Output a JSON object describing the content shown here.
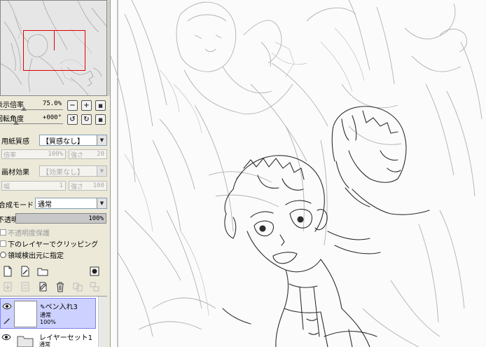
{
  "navigator": {
    "zoom_label": "表示倍率",
    "zoom_value": "75.0%",
    "zoom_level_percent": 75.0,
    "rotation_label": "回転角度",
    "rotation_value": "+000°",
    "rotation_degrees": 0,
    "buttons": [
      {
        "icon": "zoom-out-icon",
        "glyph": "−"
      },
      {
        "icon": "zoom-in-icon",
        "glyph": "+"
      },
      {
        "icon": "reset-zoom-icon",
        "glyph": "■"
      },
      {
        "icon": "rotate-left-icon",
        "glyph": "↺"
      },
      {
        "icon": "rotate-right-icon",
        "glyph": "↻"
      },
      {
        "icon": "reset-rotation-icon",
        "glyph": "■"
      }
    ],
    "frame_color": "#e00000"
  },
  "paper_texture": {
    "label": "用紙質感",
    "selected": "【質感なし】",
    "scale_key": "倍率",
    "scale_value": "100%",
    "strength_key": "強さ",
    "strength_value": "20"
  },
  "material_effect": {
    "label": "画材効果",
    "selected": "【効果なし】",
    "width_key": "幅",
    "width_value": "1",
    "strength_key": "強さ",
    "strength_value": "100"
  },
  "blend": {
    "mode_label": "合成モード",
    "mode_value": "通常",
    "opacity_label": "不透明度",
    "opacity_value": "100%",
    "opacity_percent": 100
  },
  "options": {
    "preserve_opacity": "不透明度保護",
    "clip_to_lower": "下のレイヤーでクリッピング",
    "selection_source": "領域検出元に指定"
  },
  "tools": {
    "row1": [
      "new-layer-icon",
      "new-vector-layer-icon",
      "new-folder-icon",
      "record-icon"
    ],
    "row2": [
      "transfer-down-icon",
      "merge-down-icon",
      "clear-layer-icon",
      "delete-layer-icon",
      "merge-visible-icon",
      "merge-all-icon"
    ]
  },
  "layers": [
    {
      "name": "ペン入れ3",
      "mode": "通常",
      "opacity": "100%",
      "selected": true,
      "type": "pen"
    },
    {
      "name": "レイヤーセット1",
      "mode": "通常",
      "opacity": "",
      "selected": false,
      "type": "folder"
    }
  ],
  "colors": {
    "panel_bg": "#ece9d8",
    "selected_layer_bg": "#cdd1ff",
    "selected_layer_border": "#7d84e6",
    "canvas_bg": "#fbfbfb",
    "sketch_line": "#9c9c9c",
    "ink_line": "#2a2a2a"
  }
}
